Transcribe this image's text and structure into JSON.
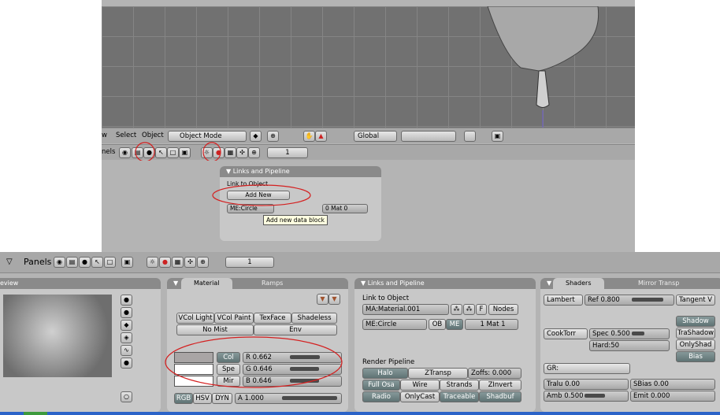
{
  "top": {
    "menu": {
      "partial_w": "w",
      "select": "Select",
      "object": "Object",
      "mode": "Object Mode",
      "orient": "Global"
    },
    "panels_partial": "nels",
    "frame": "1",
    "links_panel": {
      "title": "Links and Pipeline",
      "link_label": "Link to Object",
      "add_new": "Add New",
      "me_field": "ME:Circle",
      "mat_field": "0 Mat 0",
      "tooltip": "Add new data block"
    }
  },
  "bottom": {
    "header": {
      "panels_label": "Panels",
      "frame": "1"
    },
    "preview": {
      "title_partial": "eview"
    },
    "material": {
      "tab_material": "Material",
      "tab_ramps": "Ramps",
      "buttons": [
        "VCol Light",
        "VCol Paint",
        "TexFace",
        "Shadeless"
      ],
      "no_mist": "No Mist",
      "env": "Env",
      "col": "Col",
      "spe": "Spe",
      "mir": "Mir",
      "r": "R 0.662",
      "g": "G 0.646",
      "b": "B 0.646",
      "rgb": "RGB",
      "hsv": "HSV",
      "dyn": "DYN",
      "a": "A 1.000"
    },
    "links": {
      "title": "Links and Pipeline",
      "link_label": "Link to Object",
      "ma_field": "MA:Material.001",
      "f_btn": "F",
      "nodes_btn": "Nodes",
      "me_field": "ME:Circle",
      "ob": "OB",
      "me": "ME",
      "mat": "1 Mat 1",
      "render_label": "Render Pipeline",
      "row1": [
        "Halo",
        "ZTransp",
        "Zoffs: 0.000"
      ],
      "row2": [
        "Full Osa",
        "Wire",
        "Strands",
        "ZInvert"
      ],
      "row3": [
        "Radio",
        "OnlyCast",
        "Traceable",
        "Shadbuf"
      ]
    },
    "shaders": {
      "tab_shaders": "Shaders",
      "tab_mirror": "Mirror Transp",
      "lambert": "Lambert",
      "ref": "Ref 0.800",
      "tangent": "Tangent V",
      "shadow": "Shadow",
      "trashadow": "TraShadow",
      "onlyshad": "OnlyShad",
      "bias": "Bias",
      "cooktorr": "CookTorr",
      "spec": "Spec 0.500",
      "hard": "Hard:50",
      "gr": "GR:",
      "tralu": "Tralu 0.00",
      "sbias": "SBias 0.00",
      "amb": "Amb 0.500",
      "emit": "Emit 0.000"
    }
  },
  "colors": {
    "viewport": "#717171",
    "grid": "#808080",
    "panel": "#c8c8c8",
    "annotation": "#d42020",
    "taskbar": "#2b63c8"
  }
}
